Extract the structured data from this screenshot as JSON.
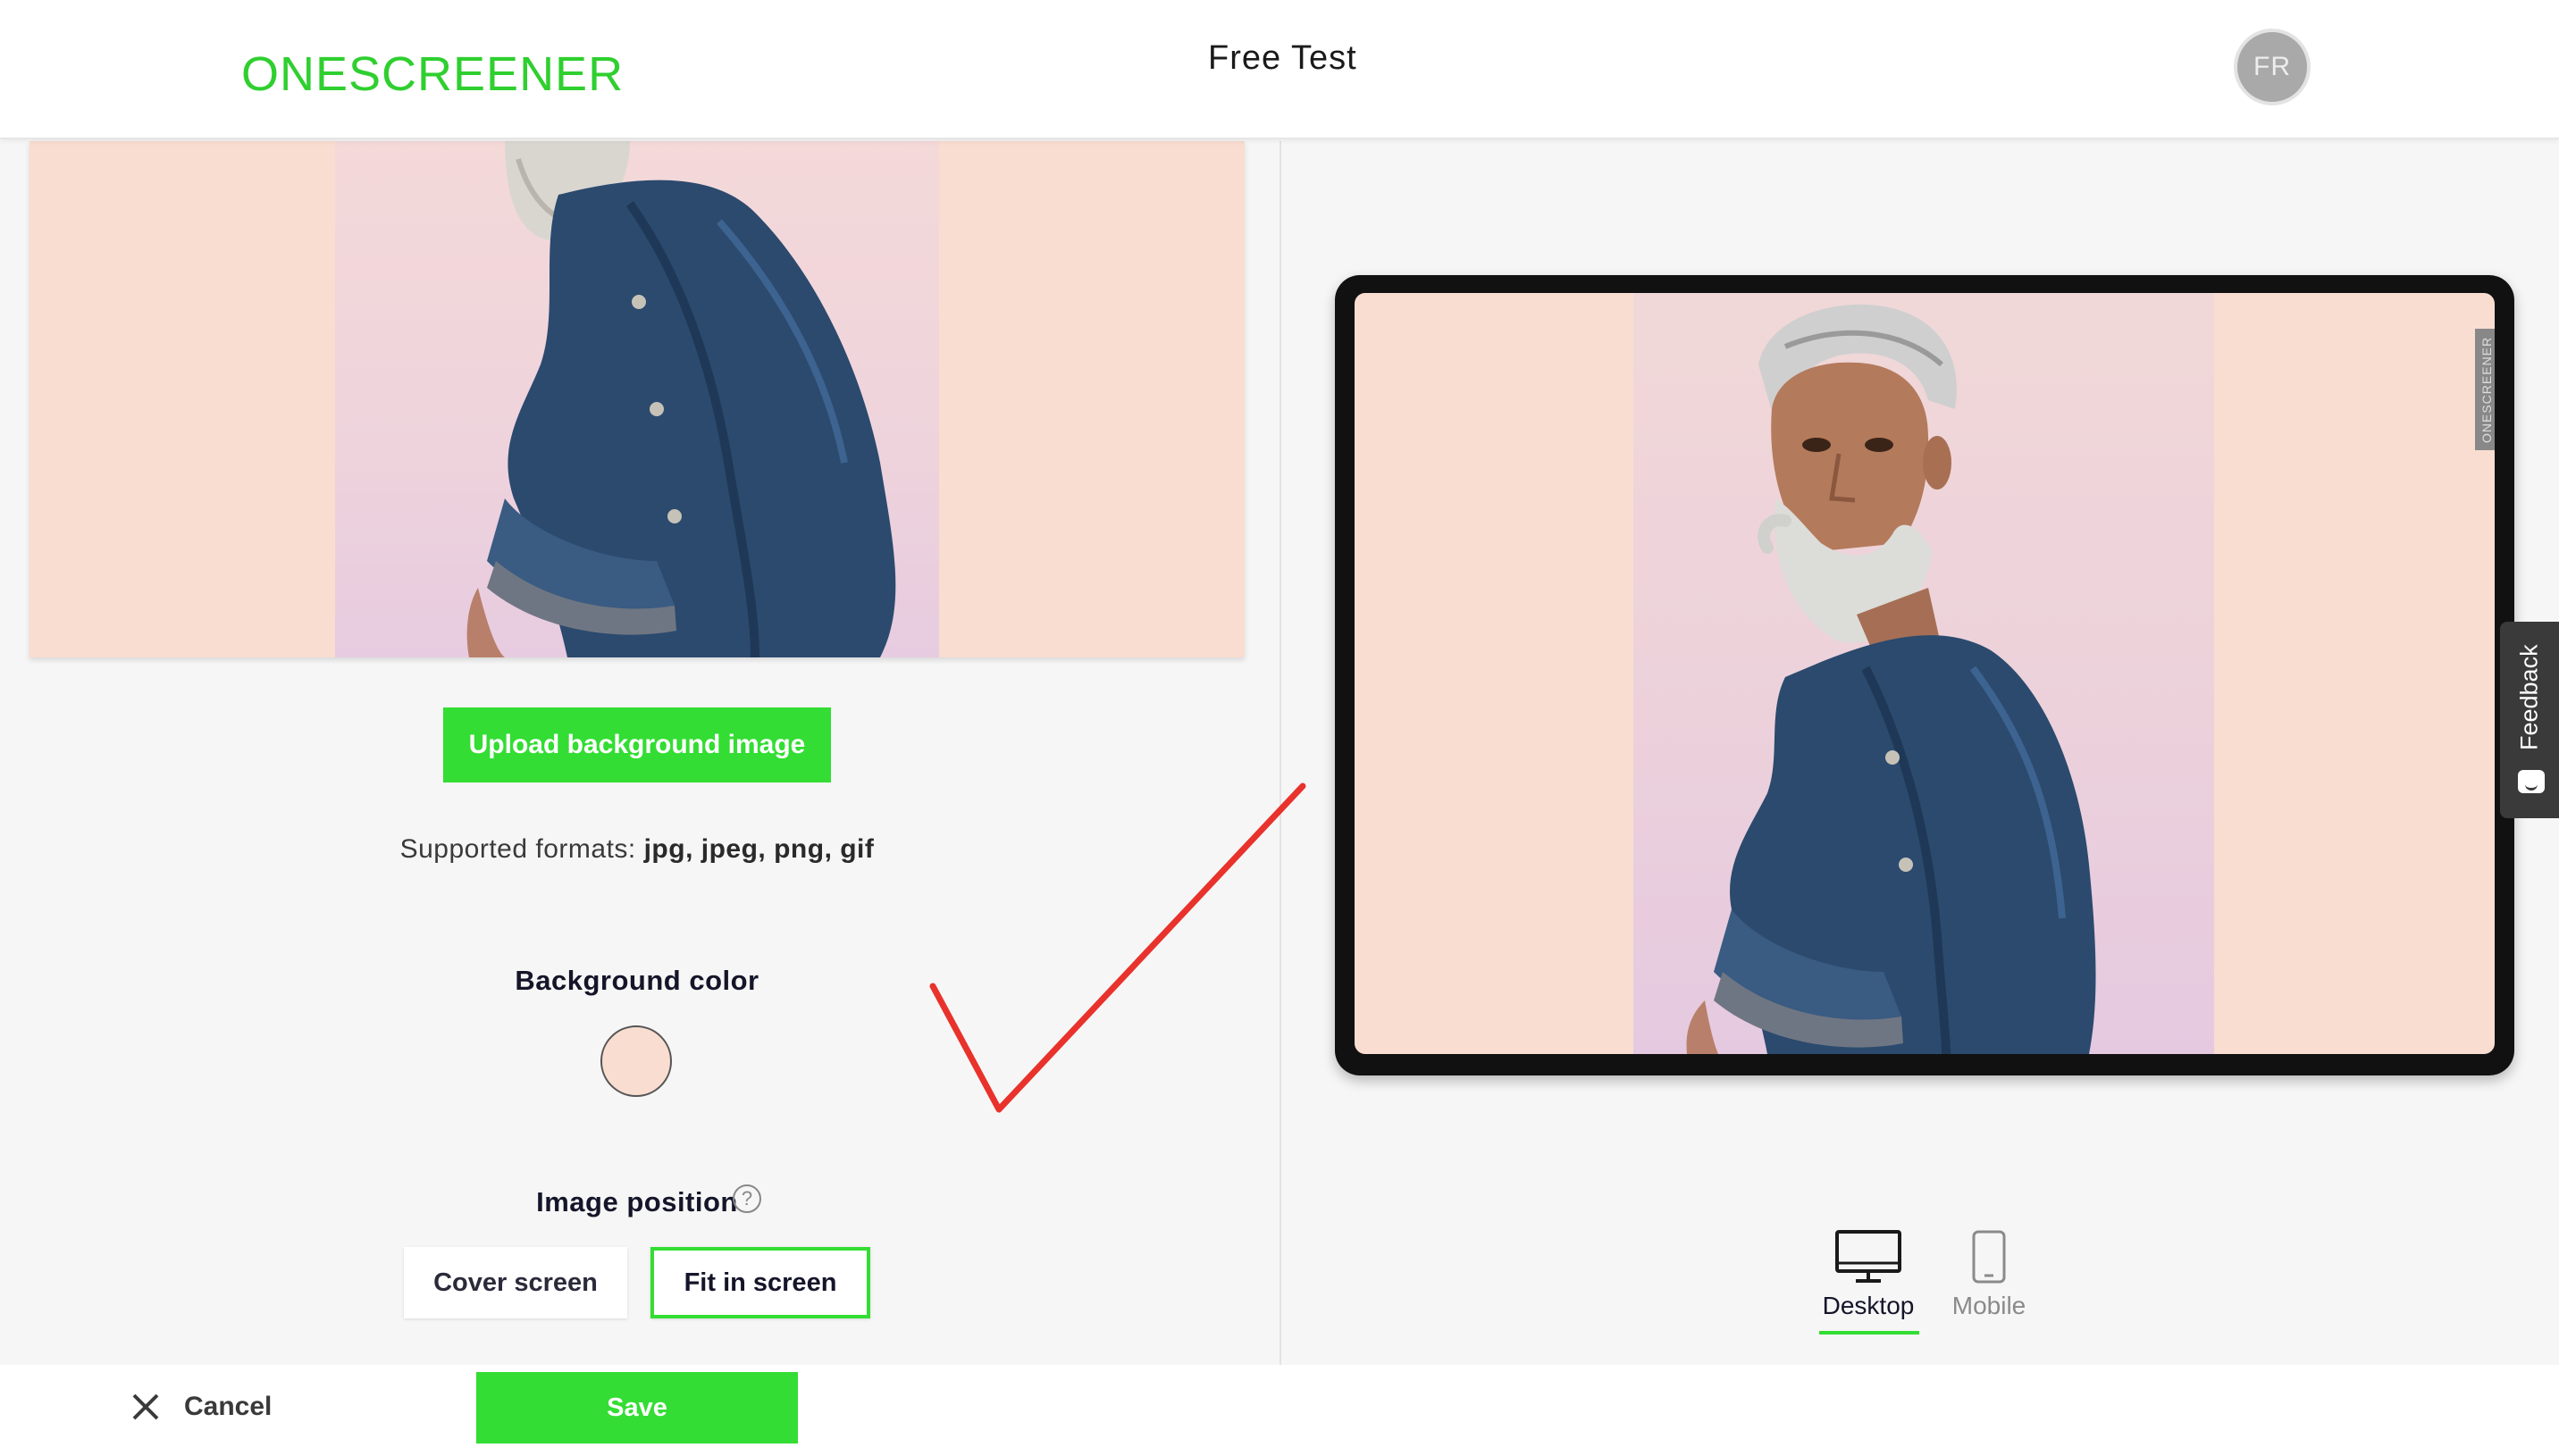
{
  "header": {
    "logo": "ONESCREENER",
    "project_title": "Free Test",
    "avatar_initials": "FR"
  },
  "editor": {
    "upload_label": "Upload background image",
    "formats_prefix": "Supported formats:",
    "formats_list": "jpg, jpeg, png, gif",
    "background_color_heading": "Background color",
    "background_color_value": "#f9ddd0",
    "image_position_heading": "Image position",
    "help_icon": "question-circle-icon",
    "position_options": [
      {
        "label": "Cover screen",
        "selected": false
      },
      {
        "label": "Fit in screen",
        "selected": true
      }
    ]
  },
  "footer": {
    "cancel_label": "Cancel",
    "save_label": "Save"
  },
  "preview": {
    "watermark": "ONESCREENER",
    "devices": [
      {
        "label": "Desktop",
        "icon": "desktop-monitor-icon",
        "active": true
      },
      {
        "label": "Mobile",
        "icon": "mobile-phone-icon",
        "active": false
      }
    ]
  },
  "feedback": {
    "label": "Feedback",
    "icon": "smiley-chat-icon"
  },
  "colors": {
    "brand_green": "#33dd33",
    "logo_green": "#2fcf2f",
    "peach_background": "#f9ddd0",
    "annotation_red": "#e8322b"
  }
}
